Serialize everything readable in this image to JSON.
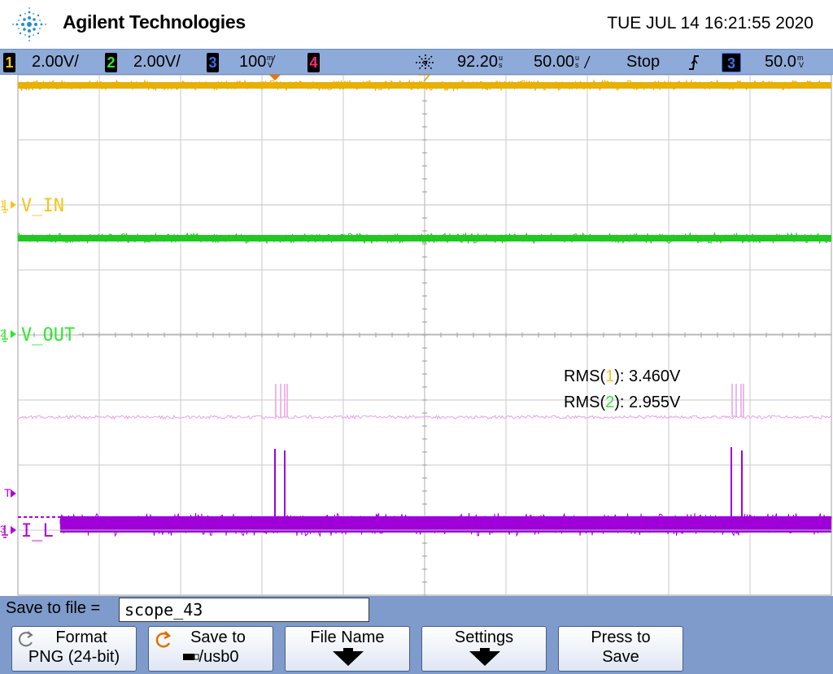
{
  "header": {
    "brand": "Agilent Technologies",
    "datetime": "TUE JUL 14 16:21:55 2020"
  },
  "status": {
    "ch1": {
      "num": "1",
      "scale": "2.00V/",
      "color": "#f5c518"
    },
    "ch2": {
      "num": "2",
      "scale": "2.00V/",
      "color": "#2ee82e"
    },
    "ch3": {
      "num": "3",
      "scale": "100",
      "unit_icon": "millivolt-per-div",
      "color": "#3a6de8"
    },
    "ch4": {
      "num": "4",
      "color": "#ff2a78"
    },
    "delay": "92.20",
    "timebase": "50.00",
    "run_state": "Stop",
    "trigger_edge": "rising-edge-icon",
    "trigger_source": "3",
    "trigger_level": "50.0"
  },
  "screen": {
    "labels": {
      "ch1": "V_IN",
      "ch2": "V_OUT",
      "ch3": "I_L",
      "ch1_marker": "1",
      "ch2_marker": "2",
      "ch3_marker": "3",
      "trigger_marker": "T"
    },
    "measurements": [
      {
        "prefix": "RMS(",
        "channel": "1",
        "suffix": "): 3.460V",
        "channel_color": "#f5c518"
      },
      {
        "prefix": "RMS(",
        "channel": "2",
        "suffix": "): 2.955V",
        "channel_color": "#2ee82e"
      }
    ],
    "colors": {
      "ch1": "#f5c518",
      "ch1_trace": "#e8b000",
      "ch2": "#2ee82e",
      "ch2_trace": "#22c822",
      "ch3": "#b000e0",
      "ch3_trace": "#a000d8",
      "ref_trace": "#e8a0e8",
      "grid": "#c8c8c8"
    }
  },
  "save": {
    "label": "Save to file =",
    "filename": "scope_43",
    "buttons": {
      "format_line1": "Format",
      "format_line2": "PNG (24-bit)",
      "saveto_line1": "Save to",
      "saveto_line2": "/usb0",
      "filename_line1": "File Name",
      "settings_line1": "Settings",
      "press_line1": "Press to",
      "press_line2": "Save"
    }
  }
}
